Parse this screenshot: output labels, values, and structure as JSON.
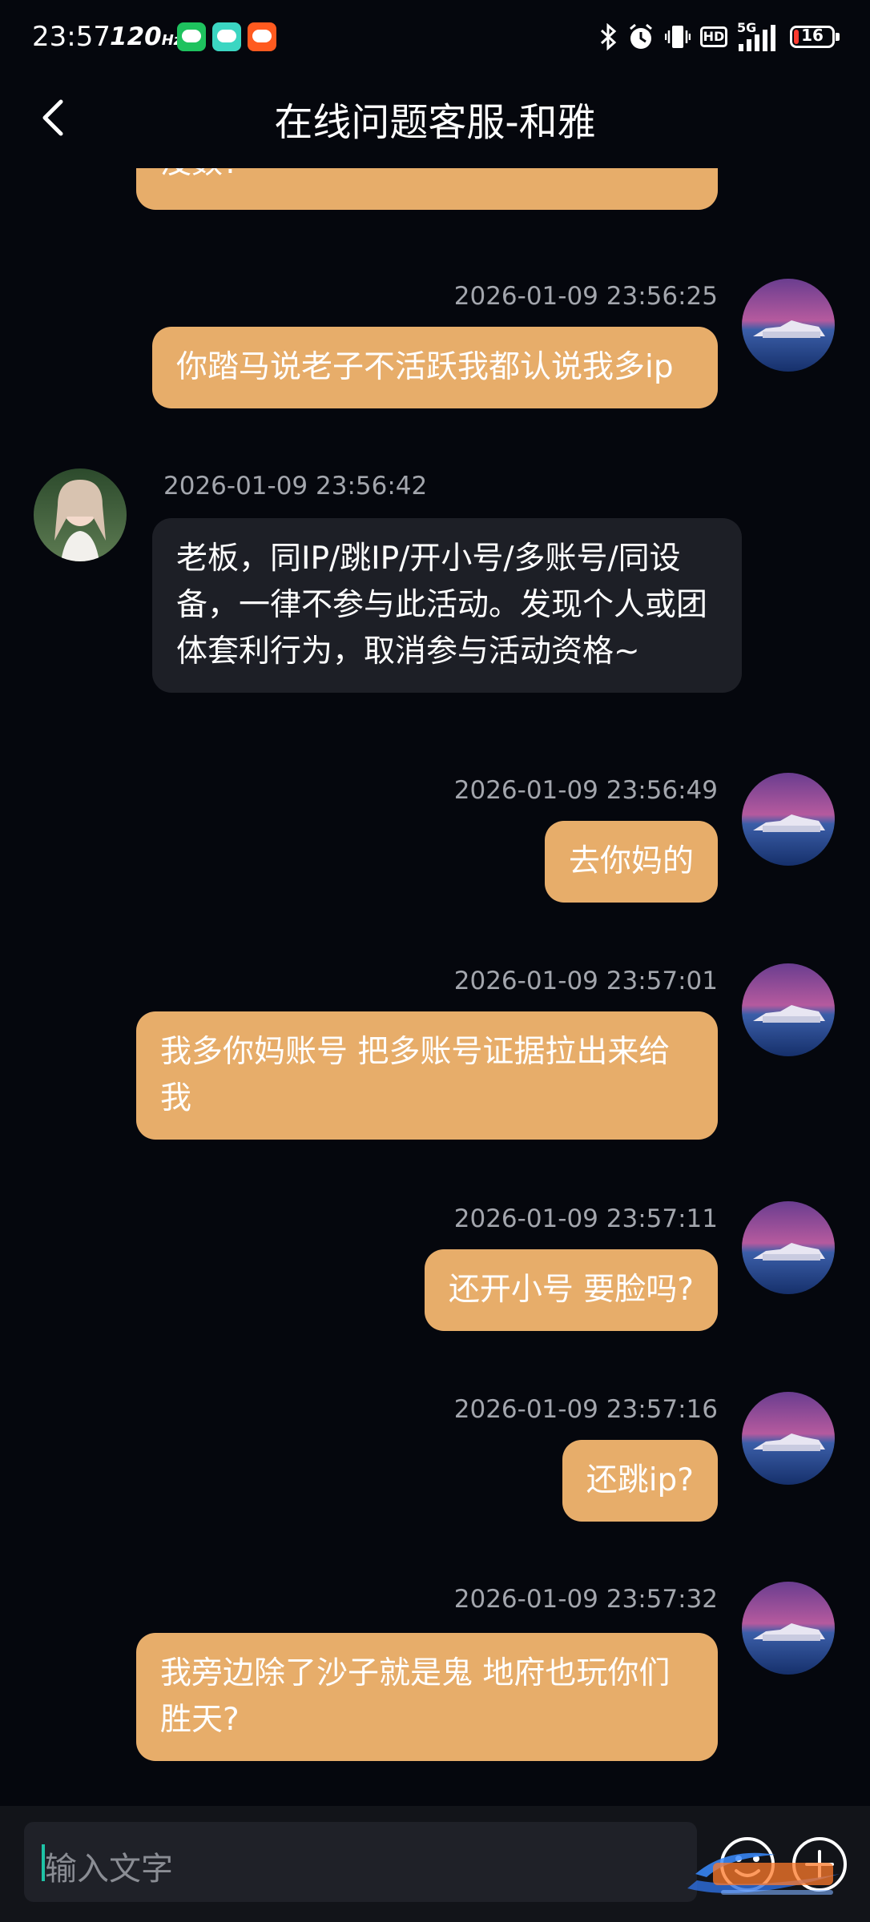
{
  "status_bar": {
    "time": "23:57",
    "refresh_rate": "120",
    "refresh_unit": "Hz",
    "network": "5G",
    "hd_label": "HD",
    "battery_level": "16"
  },
  "header": {
    "title": "在线问题客服-和雅"
  },
  "messages": [
    {
      "side": "user",
      "time": "",
      "text": "没数?"
    },
    {
      "side": "user",
      "time": "2026-01-09 23:56:25",
      "text": "你踏马说老子不活跃我都认说我多ip"
    },
    {
      "side": "agent",
      "time": "2026-01-09 23:56:42",
      "text": "老板，同IP/跳IP/开小号/多账号/同设备，一律不参与此活动。发现个人或团体套利行为，取消参与活动资格~"
    },
    {
      "side": "user",
      "time": "2026-01-09 23:56:49",
      "text": "去你妈的"
    },
    {
      "side": "user",
      "time": "2026-01-09 23:57:01",
      "text": "我多你妈账号  把多账号证据拉出来给我"
    },
    {
      "side": "user",
      "time": "2026-01-09 23:57:11",
      "text": "还开小号  要脸吗?"
    },
    {
      "side": "user",
      "time": "2026-01-09 23:57:16",
      "text": "还跳ip?"
    },
    {
      "side": "user",
      "time": "2026-01-09 23:57:32",
      "text": "我旁边除了沙子就是鬼  地府也玩你们胜天?"
    }
  ],
  "input": {
    "placeholder": "输入文字"
  },
  "icons": {
    "back": "chevron-left-icon",
    "emoji": "emoji-icon",
    "plus": "plus-circle-icon"
  },
  "colors": {
    "background": "#05070d",
    "user_bubble": "#e7ad6a",
    "agent_bubble": "#1d1f26",
    "timestamp": "#a3a6ad"
  }
}
